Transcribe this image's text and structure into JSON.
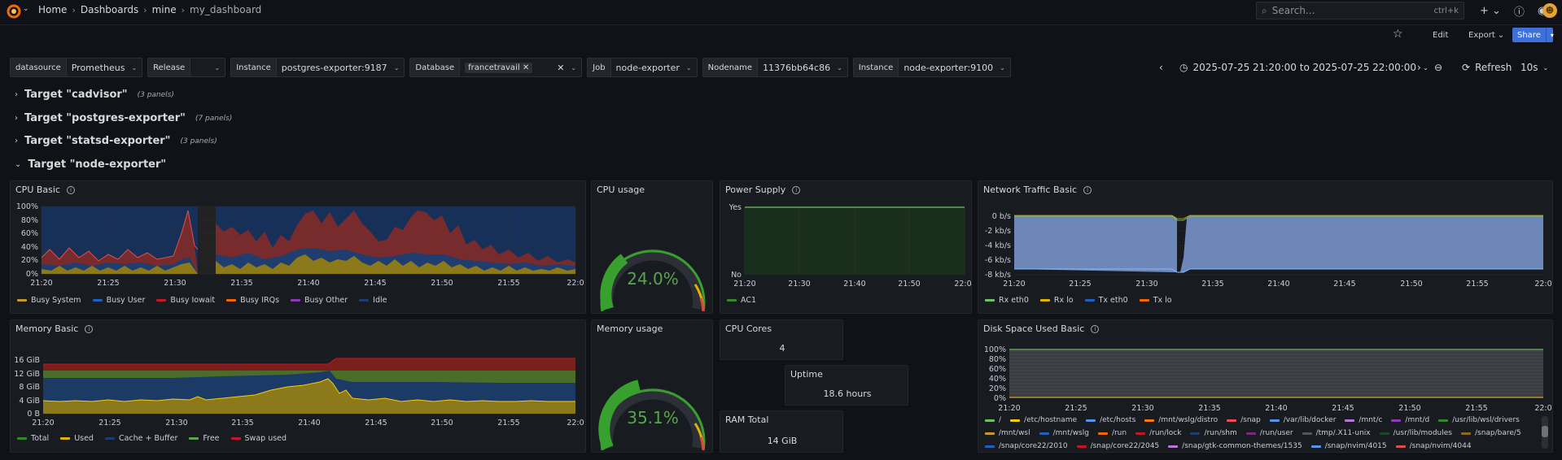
{
  "breadcrumb": {
    "home": "Home",
    "dashboards": "Dashboards",
    "folder": "mine",
    "current": "my_dashboard"
  },
  "search": {
    "placeholder": "Search...",
    "shortcut": "ctrl+k"
  },
  "actions": {
    "edit": "Edit",
    "export": "Export",
    "share": "Share"
  },
  "variables": [
    {
      "label": "datasource",
      "value": "Prometheus"
    },
    {
      "label": "Release",
      "value": ""
    },
    {
      "label": "Instance",
      "value": "postgres-exporter:9187"
    },
    {
      "label": "Database",
      "value": "francetravail"
    },
    {
      "label": "Job",
      "value": "node-exporter"
    },
    {
      "label": "Nodename",
      "value": "11376bb64c86"
    },
    {
      "label": "Instance",
      "value": "node-exporter:9100"
    }
  ],
  "time": {
    "range": "2025-07-25 21:20:00 to 2025-07-25 22:00:00",
    "refresh": "Refresh",
    "interval": "10s"
  },
  "rows": [
    {
      "title": "Target \"cadvisor\"",
      "count": "(3 panels)",
      "collapsed": true
    },
    {
      "title": "Target \"postgres-exporter\"",
      "count": "(7 panels)",
      "collapsed": true
    },
    {
      "title": "Target \"statsd-exporter\"",
      "count": "(3 panels)",
      "collapsed": true
    },
    {
      "title": "Target \"node-exporter\"",
      "count": "",
      "collapsed": false
    }
  ],
  "panels": {
    "cpu_basic": {
      "title": "CPU Basic",
      "legend": [
        "Busy System",
        "Busy User",
        "Busy Iowait",
        "Busy IRQs",
        "Busy Other",
        "Idle"
      ],
      "yticks": [
        "100%",
        "80%",
        "60%",
        "40%",
        "20%",
        "0%"
      ]
    },
    "cpu_usage": {
      "title": "CPU usage",
      "value": "24.0%"
    },
    "power_supply": {
      "title": "Power Supply",
      "yticks": [
        "Yes",
        "No"
      ],
      "legend": [
        "AC1"
      ]
    },
    "network": {
      "title": "Network Traffic Basic",
      "yticks": [
        "0 b/s",
        "-2 kb/s",
        "-4 kb/s",
        "-6 kb/s",
        "-8 kb/s"
      ],
      "legend": [
        "Rx eth0",
        "Rx lo",
        "Tx eth0",
        "Tx lo"
      ]
    },
    "memory_basic": {
      "title": "Memory Basic",
      "yticks": [
        "16 GiB",
        "12 GiB",
        "8 GiB",
        "4 GiB",
        "0 B"
      ],
      "legend": [
        "Total",
        "Used",
        "Cache + Buffer",
        "Free",
        "Swap used"
      ]
    },
    "memory_usage": {
      "title": "Memory usage",
      "value": "35.1%"
    },
    "cpu_cores": {
      "title": "CPU Cores",
      "value": "4"
    },
    "uptime": {
      "title": "Uptime",
      "value": "18.6 hours"
    },
    "ram_total": {
      "title": "RAM Total",
      "value": "14 GiB"
    },
    "disk": {
      "title": "Disk Space Used Basic",
      "yticks": [
        "100%",
        "80%",
        "60%",
        "40%",
        "20%",
        "0%"
      ],
      "legend": [
        "/",
        "/etc/hostname",
        "/etc/hosts",
        "/mnt/wslg/distro",
        "/snap",
        "/var/lib/docker",
        "/mnt/c",
        "/mnt/d",
        "/usr/lib/wsl/drivers",
        "/mnt/wsl",
        "/mnt/wslg",
        "/run",
        "/run/lock",
        "/run/shm",
        "/run/user",
        "/tmp/.X11-unix",
        "/usr/lib/modules",
        "/snap/bare/5",
        "/snap/core22/2010",
        "/snap/core22/2045",
        "/snap/gtk-common-themes/1535",
        "/snap/nvim/4015",
        "/snap/nvim/4044"
      ]
    }
  },
  "xticks": [
    "21:20",
    "21:25",
    "21:30",
    "21:35",
    "21:40",
    "21:45",
    "21:50",
    "21:55",
    "22:0"
  ],
  "colors": {
    "green": "#37872d",
    "yellow": "#e0b400",
    "blue": "#1f60c4",
    "red": "#c4162a",
    "orange": "#fa6400",
    "purple": "#8f3bb8",
    "cyan": "#8ab8ff"
  }
}
